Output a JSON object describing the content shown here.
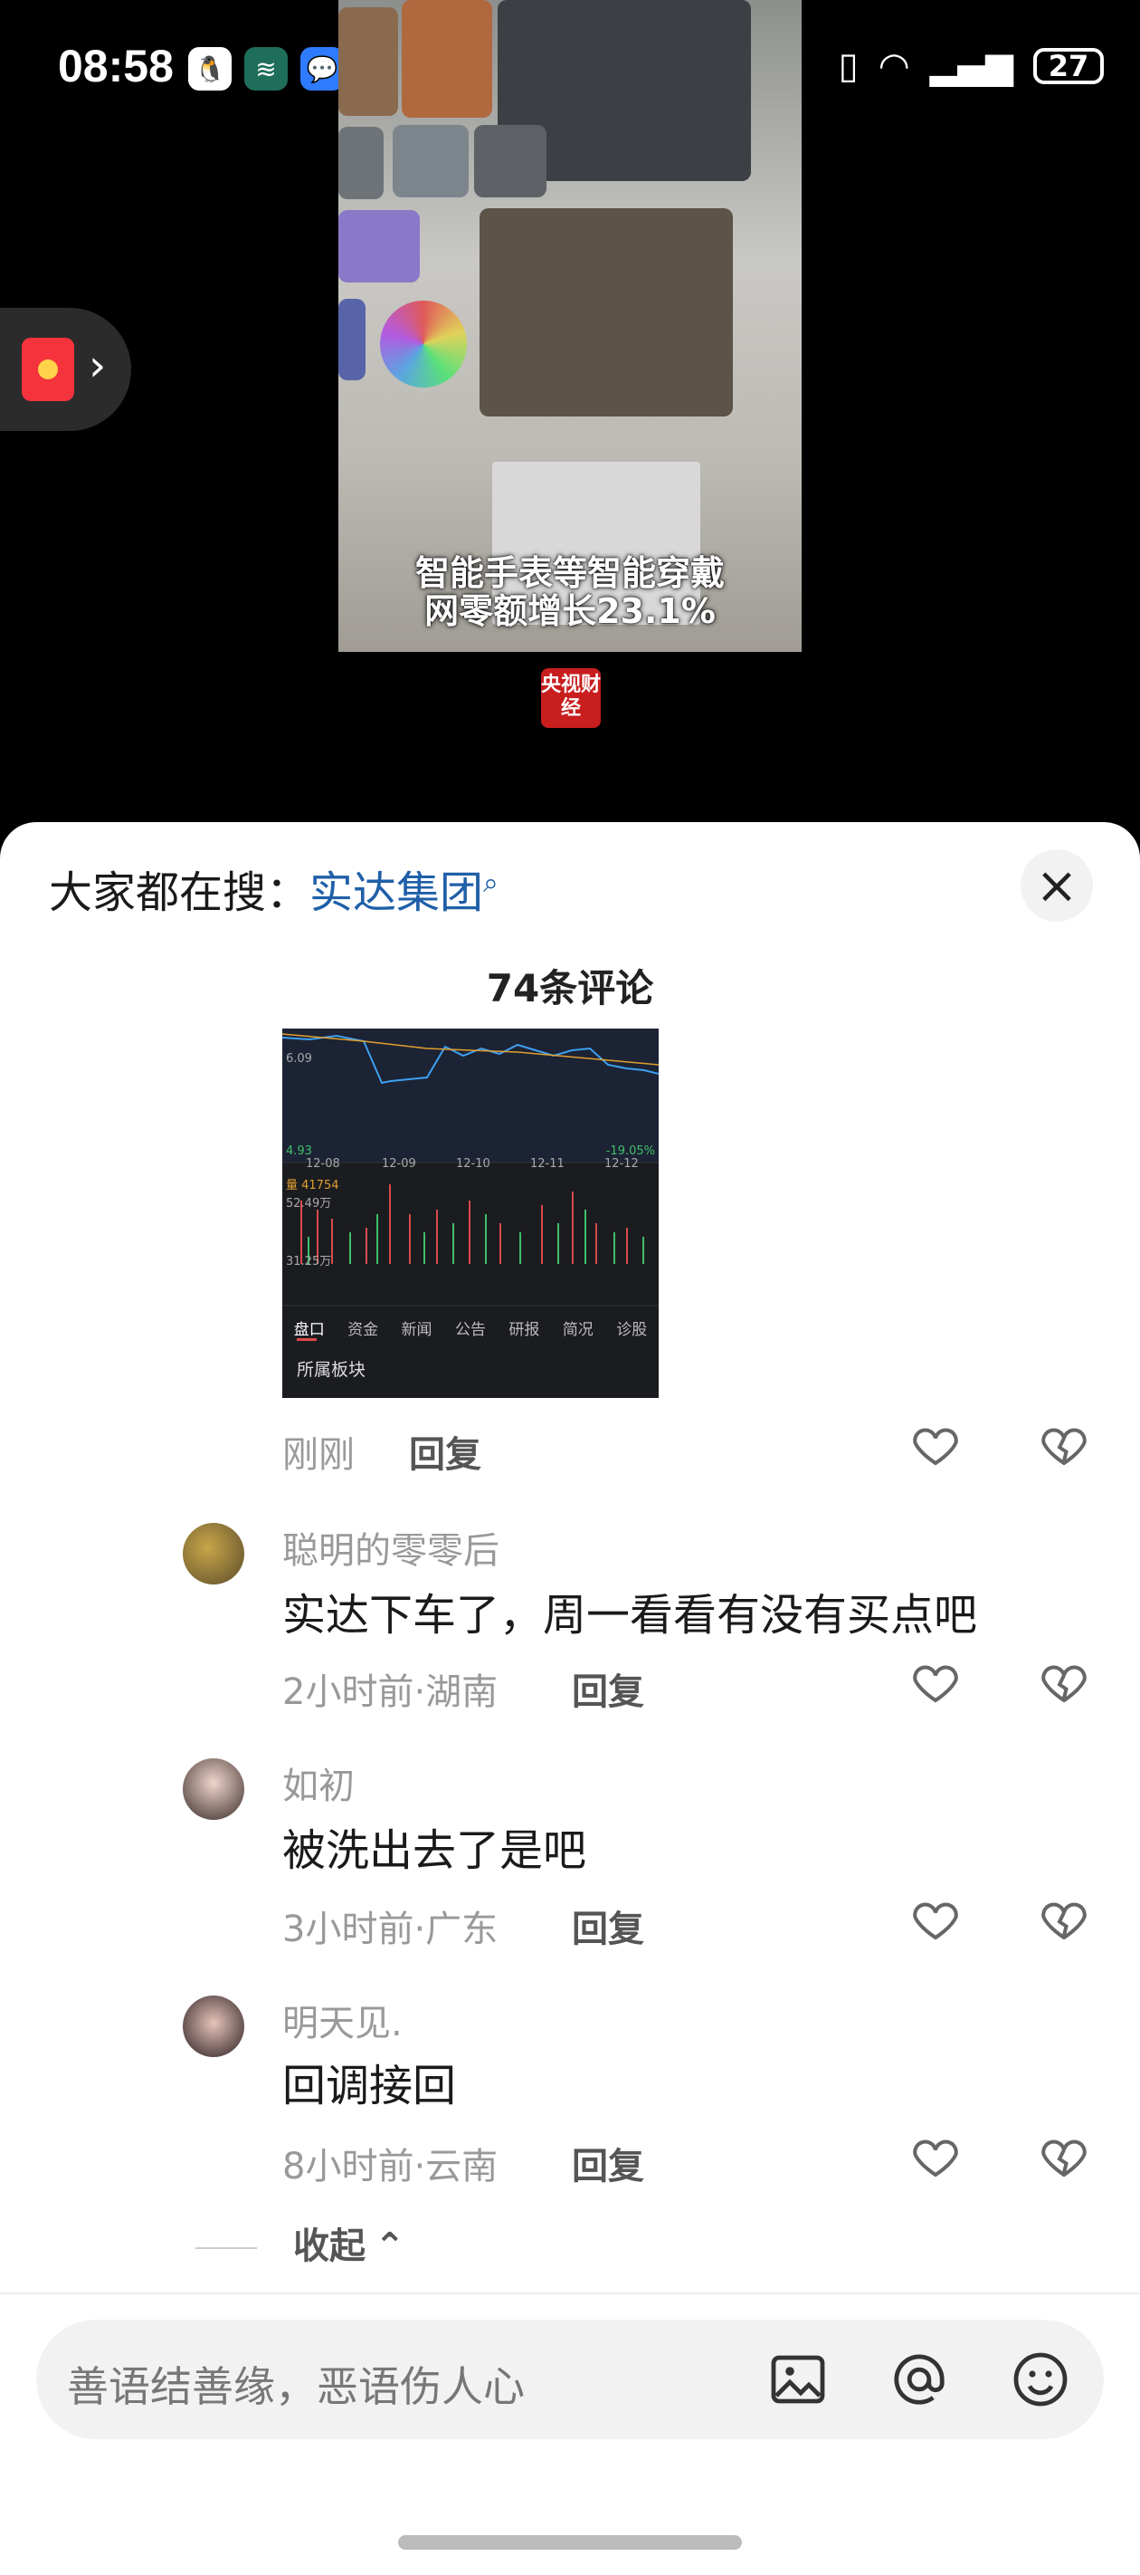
{
  "status": {
    "time": "08:58",
    "battery": "27"
  },
  "video": {
    "caption_line1": "智能手表等智能穿戴",
    "caption_line2": "网零额增长23.1%",
    "logo": "央视财经"
  },
  "sheet": {
    "search_prefix": "大家都在搜：",
    "search_keyword": "实达集团",
    "comment_count": "74条评论",
    "close_label": "×"
  },
  "stock_image": {
    "dates": [
      "12-08",
      "12-09",
      "12-10",
      "12-11",
      "12-12"
    ],
    "price_high": "6.09",
    "price_low": "4.93",
    "change": "-19.05%",
    "volume_label": "量 41754",
    "vol_max": "52.49万",
    "vol_mid": "31.25万",
    "tabs": [
      "盘口",
      "资金",
      "新闻",
      "公告",
      "研报",
      "简况",
      "诊股"
    ],
    "board": "所属板块"
  },
  "top_comment": {
    "time": "刚刚",
    "reply": "回复"
  },
  "comments": [
    {
      "user": "聪明的零零后",
      "text": "实达下车了，周一看看有没有买点吧",
      "time": "2小时前·湖南",
      "reply": "回复"
    },
    {
      "user": "如初",
      "text": "被洗出去了是吧",
      "time": "3小时前·广东",
      "reply": "回复"
    },
    {
      "user": "明天见.",
      "text": "回调接回",
      "time": "8小时前·云南",
      "reply": "回复"
    }
  ],
  "collapse_label": "收起",
  "input": {
    "placeholder": "善语结善缘，恶语伤人心"
  },
  "colors": {
    "keyword": "#1f5fa8",
    "red_packet": "#f4333c"
  }
}
